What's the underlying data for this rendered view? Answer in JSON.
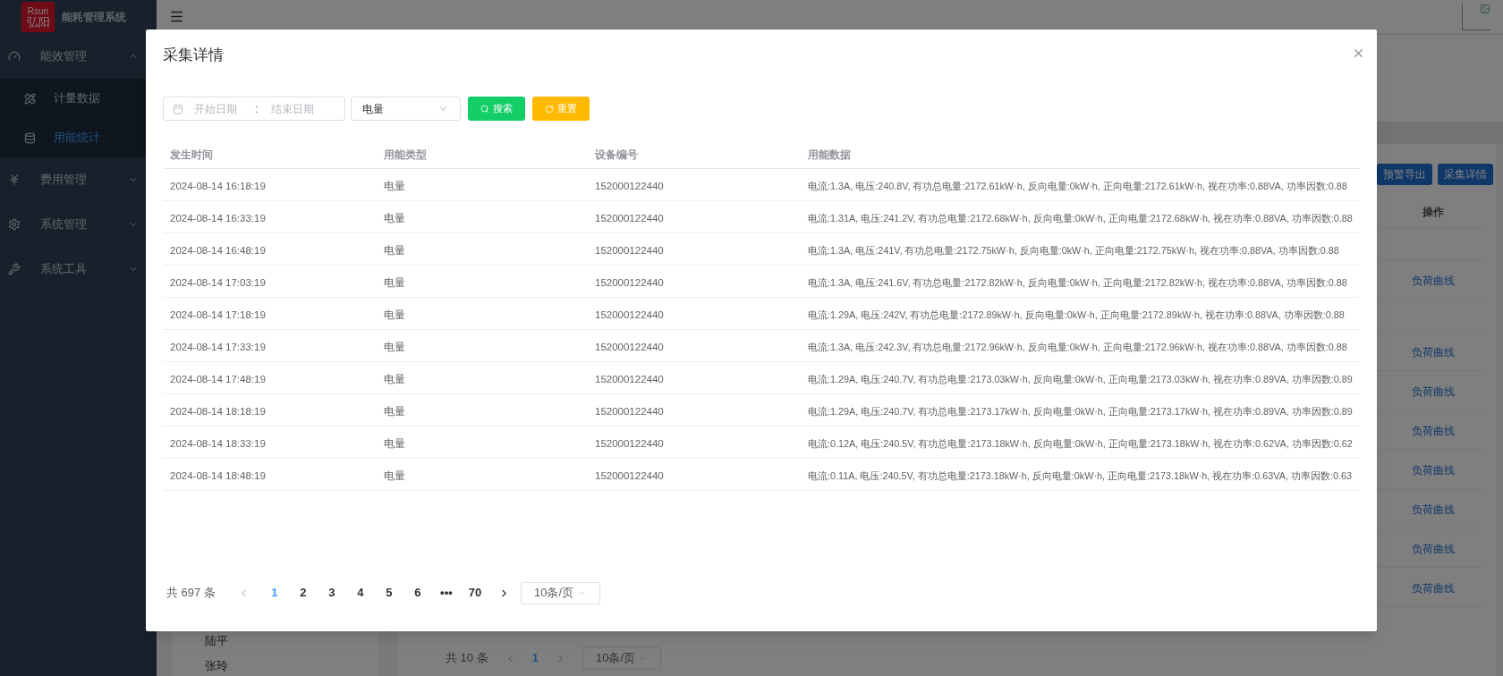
{
  "sidebar": {
    "logo": {
      "top": "Rsun",
      "bottom": "弘阳"
    },
    "title": "能耗管理系统",
    "items": [
      {
        "label": "能效管理",
        "expanded": true,
        "children": [
          {
            "label": "计量数据",
            "selected": false
          },
          {
            "label": "用能统计",
            "selected": true
          }
        ]
      },
      {
        "label": "费用管理",
        "expanded": false
      },
      {
        "label": "系统管理",
        "expanded": false
      },
      {
        "label": "系统工具",
        "expanded": false
      }
    ]
  },
  "background": {
    "toolbar": [
      "预警导出",
      "采集详情"
    ],
    "table": {
      "columns": [
        "操作"
      ],
      "rows": [
        {
          "kind": "blank"
        },
        {
          "kind": "link",
          "action": "负荷曲线"
        },
        {
          "kind": "blank"
        },
        {
          "kind": "link",
          "action": "负荷曲线"
        },
        {
          "kind": "link",
          "action": "负荷曲线"
        },
        {
          "kind": "link",
          "action": "负荷曲线"
        },
        {
          "kind": "link",
          "action": "负荷曲线"
        },
        {
          "kind": "link",
          "action": "负荷曲线"
        },
        {
          "kind": "link",
          "action": "负荷曲线"
        },
        {
          "kind": "link",
          "action": "负荷曲线"
        }
      ]
    },
    "people": [
      "陆平",
      "张玲"
    ],
    "pagination": {
      "total": "共 10 条",
      "pages": [
        {
          "label": "1",
          "selected": true
        }
      ],
      "page_size": "10条/页"
    }
  },
  "dialog": {
    "title": "采集详情",
    "filters": {
      "date_range": {
        "start_placeholder": "开始日期",
        "separator": ":",
        "end_placeholder": "结束日期"
      },
      "energy_type": {
        "value": "电量"
      },
      "buttons": [
        {
          "label": "搜索",
          "kind": "search"
        },
        {
          "label": "重置",
          "kind": "reset"
        }
      ]
    },
    "table": {
      "columns": [
        "发生时间",
        "用能类型",
        "设备编号",
        "用能数据"
      ],
      "rows": [
        [
          "2024-08-14 16:18:19",
          "电量",
          "152000122440",
          "电流:1.3A, 电压:240.8V, 有功总电量:2172.61kW·h, 反向电量:0kW·h, 正向电量:2172.61kW·h, 视在功率:0.88VA, 功率因数:0.88"
        ],
        [
          "2024-08-14 16:33:19",
          "电量",
          "152000122440",
          "电流:1.31A, 电压:241.2V, 有功总电量:2172.68kW·h, 反向电量:0kW·h, 正向电量:2172.68kW·h, 视在功率:0.88VA, 功率因数:0.88"
        ],
        [
          "2024-08-14 16:48:19",
          "电量",
          "152000122440",
          "电流:1.3A, 电压:241V, 有功总电量:2172.75kW·h, 反向电量:0kW·h, 正向电量:2172.75kW·h, 视在功率:0.88VA, 功率因数:0.88"
        ],
        [
          "2024-08-14 17:03:19",
          "电量",
          "152000122440",
          "电流:1.3A, 电压:241.6V, 有功总电量:2172.82kW·h, 反向电量:0kW·h, 正向电量:2172.82kW·h, 视在功率:0.88VA, 功率因数:0.88"
        ],
        [
          "2024-08-14 17:18:19",
          "电量",
          "152000122440",
          "电流:1.29A, 电压:242V, 有功总电量:2172.89kW·h, 反向电量:0kW·h, 正向电量:2172.89kW·h, 视在功率:0.88VA, 功率因数:0.88"
        ],
        [
          "2024-08-14 17:33:19",
          "电量",
          "152000122440",
          "电流:1.3A, 电压:242.3V, 有功总电量:2172.96kW·h, 反向电量:0kW·h, 正向电量:2172.96kW·h, 视在功率:0.88VA, 功率因数:0.88"
        ],
        [
          "2024-08-14 17:48:19",
          "电量",
          "152000122440",
          "电流:1.29A, 电压:240.7V, 有功总电量:2173.03kW·h, 反向电量:0kW·h, 正向电量:2173.03kW·h, 视在功率:0.89VA, 功率因数:0.89"
        ],
        [
          "2024-08-14 18:18:19",
          "电量",
          "152000122440",
          "电流:1.29A, 电压:240.7V, 有功总电量:2173.17kW·h, 反向电量:0kW·h, 正向电量:2173.17kW·h, 视在功率:0.89VA, 功率因数:0.89"
        ],
        [
          "2024-08-14 18:33:19",
          "电量",
          "152000122440",
          "电流:0.12A, 电压:240.5V, 有功总电量:2173.18kW·h, 反向电量:0kW·h, 正向电量:2173.18kW·h, 视在功率:0.62VA, 功率因数:0.62"
        ],
        [
          "2024-08-14 18:48:19",
          "电量",
          "152000122440",
          "电流:0.11A, 电压:240.5V, 有功总电量:2173.18kW·h, 反向电量:0kW·h, 正向电量:2173.18kW·h, 视在功率:0.63VA, 功率因数:0.63"
        ]
      ]
    },
    "pagination": {
      "total": "共 697 条",
      "pages": [
        {
          "label": "1",
          "selected": true
        },
        {
          "label": "2",
          "selected": false
        },
        {
          "label": "3",
          "selected": false
        },
        {
          "label": "4",
          "selected": false
        },
        {
          "label": "5",
          "selected": false
        },
        {
          "label": "6",
          "selected": false
        },
        {
          "label": "•••",
          "selected": false
        },
        {
          "label": "70",
          "selected": false
        }
      ],
      "page_size": "10条/页"
    }
  }
}
